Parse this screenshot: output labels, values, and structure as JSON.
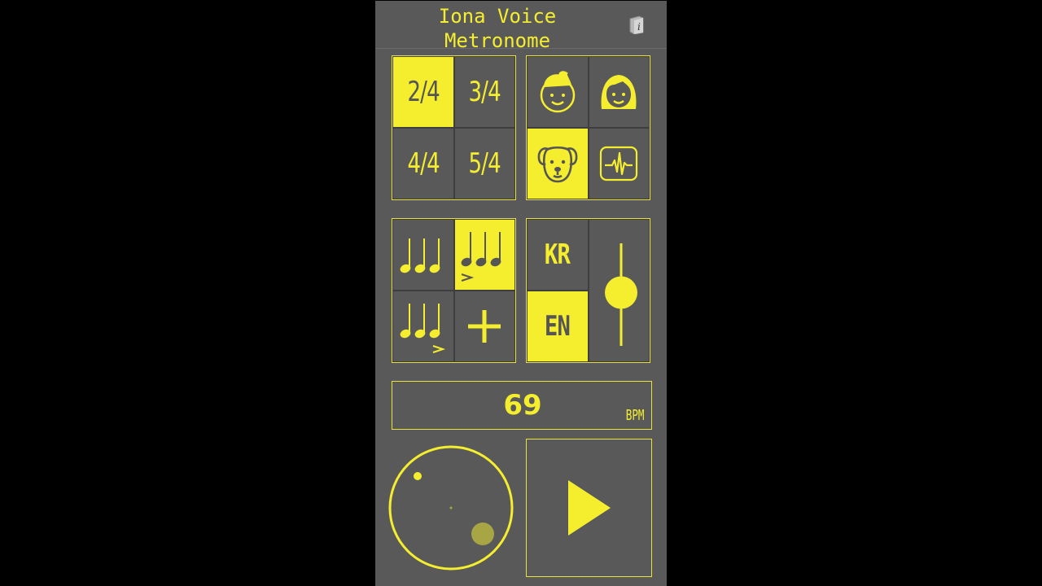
{
  "app": {
    "title_line1": "Iona Voice",
    "title_line2": "Metronome"
  },
  "time_signatures": [
    {
      "label": "2/4",
      "selected": true
    },
    {
      "label": "3/4",
      "selected": false
    },
    {
      "label": "4/4",
      "selected": false
    },
    {
      "label": "5/4",
      "selected": false
    }
  ],
  "voices": [
    {
      "icon": "boy-face-icon",
      "selected": false
    },
    {
      "icon": "girl-face-icon",
      "selected": false
    },
    {
      "icon": "dog-face-icon",
      "selected": true
    },
    {
      "icon": "waveform-monitor-icon",
      "selected": false
    }
  ],
  "accent_patterns": [
    {
      "icon": "three-notes-icon",
      "selected": false
    },
    {
      "icon": "three-notes-first-accent-icon",
      "selected": true
    },
    {
      "icon": "three-notes-last-accent-icon",
      "selected": false
    },
    {
      "icon": "plus-icon",
      "selected": false
    }
  ],
  "languages": [
    {
      "label": "KR",
      "selected": false
    },
    {
      "label": "EN",
      "selected": true
    }
  ],
  "volume": {
    "level": 0.52
  },
  "tempo": {
    "value": "69",
    "unit": "BPM"
  },
  "colors": {
    "accent": "#f5ee2f",
    "background": "#595959",
    "frame": "#000000"
  }
}
